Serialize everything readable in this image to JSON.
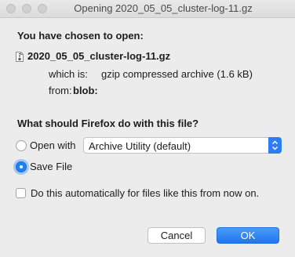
{
  "window": {
    "title": "Opening 2020_05_05_cluster-log-11.gz"
  },
  "dialog": {
    "heading": "You have chosen to open:",
    "filename": "2020_05_05_cluster-log-11.gz",
    "which_is_label": "which is:",
    "which_is_value": "gzip compressed archive (1.6 kB)",
    "from_label": "from:",
    "from_value": "blob:",
    "question": "What should Firefox do with this file?",
    "open_with_label": "Open with",
    "open_with_app": "Archive Utility (default)",
    "save_file_label": "Save File",
    "auto_label": "Do this automatically for files like this from now on.",
    "selected_action": "save",
    "auto_checked": false
  },
  "buttons": {
    "cancel": "Cancel",
    "ok": "OK"
  },
  "colors": {
    "accent": "#1a82fb",
    "background": "#ececec"
  }
}
